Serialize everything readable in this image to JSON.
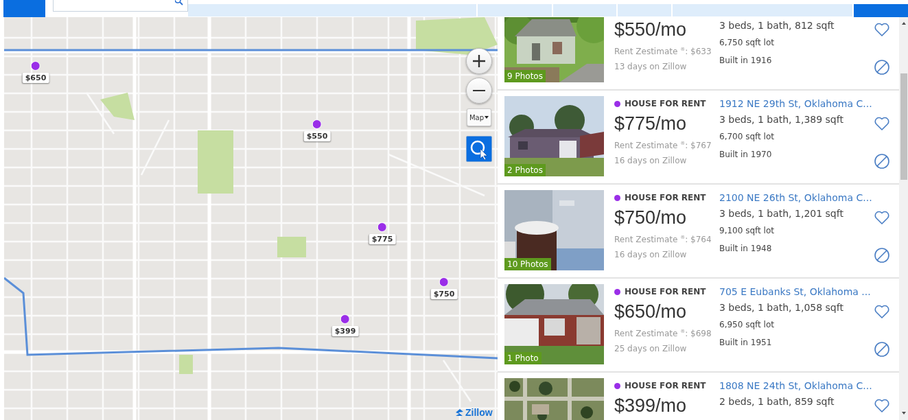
{
  "map": {
    "pins": [
      {
        "price": "$650"
      },
      {
        "price": "$550"
      },
      {
        "price": "$775"
      },
      {
        "price": "$750"
      },
      {
        "price": "$399"
      }
    ],
    "map_type": "Map",
    "logo": "Zillow"
  },
  "listings": [
    {
      "photo": {
        "kind": "picture",
        "label": "9 Photos"
      },
      "price": "$550/mo",
      "zestimate": "Rent Zestimate $^{®}$: $633",
      "days": "13 days on Zillow",
      "facts": "3 beds, 1 bath, 812 sqft",
      "lot": "6,750 sqft lot",
      "built": "Built in 1916"
    },
    {
      "photo": {
        "kind": "picture",
        "label": "2 Photos"
      },
      "type": "HOUSE FOR RENT",
      "address": "1912 NE 29th St, Oklahoma C...",
      "price": "$775/mo",
      "zestimate": "Rent Zestimate $^{®}$: $767",
      "days": "16 days on Zillow",
      "facts": "3 beds, 1 bath, 1,389 sqft",
      "lot": "6,700 sqft lot",
      "built": "Built in 1970"
    },
    {
      "photo": {
        "kind": "picture",
        "label": "10 Photos"
      },
      "type": "HOUSE FOR RENT",
      "address": "2100 NE 26th St, Oklahoma C...",
      "price": "$750/mo",
      "zestimate": "Rent Zestimate $^{®}$: $764",
      "days": "16 days on Zillow",
      "facts": "3 beds, 1 bath, 1,201 sqft",
      "lot": "9,100 sqft lot",
      "built": "Built in 1948"
    },
    {
      "photo": {
        "kind": "picture",
        "label": "1 Photo"
      },
      "type": "HOUSE FOR RENT",
      "address": "705 E Eubanks St, Oklahoma ...",
      "price": "$650/mo",
      "zestimate": "Rent Zestimate $^{®}$: $698",
      "days": "25 days on Zillow",
      "facts": "3 beds, 1 bath, 1,058 sqft",
      "lot": "6,950 sqft lot",
      "built": "Built in 1951"
    },
    {
      "type": "HOUSE FOR RENT",
      "address": "1808 NE 24th St, Oklahoma C...",
      "price": "$399/mo",
      "facts": "2 beds, 1 bath, 859 sqft"
    }
  ]
}
